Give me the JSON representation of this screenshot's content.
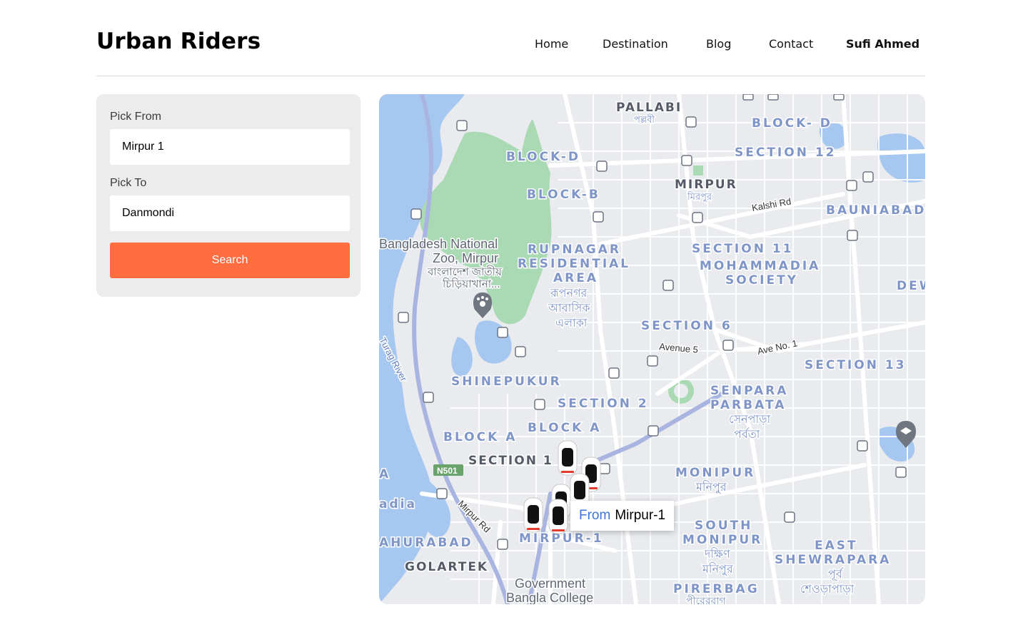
{
  "app": {
    "title": "Urban Riders"
  },
  "nav": {
    "home": "Home",
    "destination": "Destination",
    "blog": "Blog",
    "contact": "Contact",
    "user": "Sufi Ahmed"
  },
  "search": {
    "pick_from_label": "Pick From",
    "pick_from_value": "Mirpur 1",
    "pick_to_label": "Pick To",
    "pick_to_value": "Danmondi",
    "button_label": "Search"
  },
  "map": {
    "area_labels": {
      "pallabi": "PALLABI",
      "pallabi_bn": "পল্লবী",
      "block_d_top": "BLOCK- D",
      "block_d": "BLOCK-D",
      "section_12": "SECTION 12",
      "mirpur": "MIRPUR",
      "mirpur_bn": "মিরপুর",
      "block_b": "BLOCK-B",
      "bauniabad": "BAUNIABAD",
      "rupnagar_1": "RUPNAGAR",
      "rupnagar_2": "RESIDENTIAL",
      "rupnagar_3": "AREA",
      "rupnagar_bn_1": "রূপনগর",
      "rupnagar_bn_2": "আবাসিক",
      "rupnagar_bn_3": "এলাকা",
      "section_11": "SECTION 11",
      "mohammadia_1": "MOHAMMADIA",
      "mohammadia_2": "SOCIETY",
      "dew": "DEW",
      "section_6": "SECTION 6",
      "section_13": "SECTION 13",
      "shinepukur": "SHINEPUKUR",
      "section_2": "SECTION 2",
      "senpara_1": "SENPARA",
      "senpara_2": "PARBATA",
      "senpara_bn_1": "সেনপাড়া",
      "senpara_bn_2": "পর্বতা",
      "block_a_left": "BLOCK A",
      "block_a": "BLOCK A",
      "section_1": "SECTION 1",
      "monipur": "MONIPUR",
      "monipur_bn": "মনিপুর",
      "mirpur_1": "MIRPUR-1",
      "south_monipur_1": "SOUTH",
      "south_monipur_2": "MONIPUR",
      "south_monipur_bn_1": "দক্ষিণ",
      "south_monipur_bn_2": "মনিপুর",
      "east_shewrapara_1": "EAST",
      "east_shewrapara_2": "SHEWRAPARA",
      "east_shewrapara_bn_1": "পূর্ব",
      "east_shewrapara_bn_2": "শেওড়াপাড়া",
      "ahurabad": "AHURABAD",
      "golartek": "GOLARTEK",
      "pirerbag": "PIRERBAG",
      "pirerbag_bn": "পীরেরবাগ",
      "a_left": "A",
      "dia_left": "adia"
    },
    "poi_labels": {
      "zoo_1": "Bangladesh National",
      "zoo_2": "Zoo, Mirpur",
      "zoo_bn_1": "বাংলাদেশ জাতীয়",
      "zoo_bn_2": "চিড়িয়াখানা...",
      "college_1": "Government",
      "college_2": "Bangla College"
    },
    "road_labels": {
      "kalshi": "Kalshi Rd",
      "avenue5": "Avenue 5",
      "ave1": "Ave No. 1",
      "mirpur_rd": "Mirpur Rd",
      "turag": "Turag River",
      "n501": "N501"
    },
    "tooltip": {
      "from": "From",
      "place": "Mirpur-1"
    },
    "colors": {
      "water": "#a6c8f0",
      "park": "#a9dab3",
      "land": "#e9ebee",
      "road": "#ffffff",
      "highway": "#a9b5e0",
      "accent": "#ff6d40"
    }
  }
}
